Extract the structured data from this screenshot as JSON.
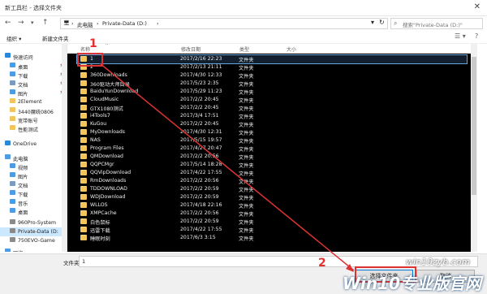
{
  "window": {
    "title": "新工具栏 - 选择文件夹",
    "close_glyph": "✕"
  },
  "nav": {
    "back": "←",
    "forward": "→",
    "dropdown": "▾",
    "up": "↑",
    "refresh": "↻"
  },
  "address": {
    "crumbs": [
      "🖥",
      "›",
      "此电脑",
      "›",
      "Private-Data (D:)",
      "›"
    ]
  },
  "search": {
    "placeholder": "搜索\"Private-Data (D:)\""
  },
  "toolbar": {
    "organize": "组织 ▾",
    "new_folder": "新建文件夹",
    "view_glyph": "☰ ▾",
    "help_glyph": "?"
  },
  "sidebar": {
    "items": [
      {
        "label": "快速访问",
        "icon": "star",
        "color": "#2b87d8",
        "pin": ""
      },
      {
        "label": "桌面",
        "icon": "desktop",
        "color": "#4d9be0",
        "pin": "📌"
      },
      {
        "label": "下载",
        "icon": "download",
        "color": "#4d9be0",
        "pin": "📌"
      },
      {
        "label": "文档",
        "icon": "documents",
        "color": "#7a9bbd",
        "pin": "📌"
      },
      {
        "label": "图片",
        "icon": "pictures",
        "color": "#4d9be0",
        "pin": "📌"
      },
      {
        "label": "2Element",
        "icon": "folder",
        "color": "#f2c55c",
        "pin": ""
      },
      {
        "label": "3440魔统0806",
        "icon": "folder",
        "color": "#f2c55c",
        "pin": ""
      },
      {
        "label": "宽带账号",
        "icon": "folder",
        "color": "#f2c55c",
        "pin": ""
      },
      {
        "label": "性能测试",
        "icon": "folder",
        "color": "#f2c55c",
        "pin": ""
      },
      {
        "label": "OneDrive",
        "icon": "cloud",
        "color": "#2b87d8",
        "pin": ""
      },
      {
        "label": "此电脑",
        "icon": "computer",
        "color": "#4d9be0",
        "pin": ""
      },
      {
        "label": "视频",
        "icon": "videos",
        "color": "#4d9be0",
        "pin": ""
      },
      {
        "label": "图片",
        "icon": "pictures",
        "color": "#4d9be0",
        "pin": ""
      },
      {
        "label": "文档",
        "icon": "documents",
        "color": "#7a9bbd",
        "pin": ""
      },
      {
        "label": "下载",
        "icon": "download",
        "color": "#4d9be0",
        "pin": ""
      },
      {
        "label": "音乐",
        "icon": "music",
        "color": "#4d9be0",
        "pin": ""
      },
      {
        "label": "桌面",
        "icon": "desktop",
        "color": "#4d9be0",
        "pin": ""
      },
      {
        "label": "960Pro-System",
        "icon": "drive",
        "color": "#8a8a8a",
        "pin": ""
      },
      {
        "label": "Private-Data (D:",
        "icon": "drive",
        "color": "#8a8a8a",
        "pin": ""
      },
      {
        "label": "750EVO-Game",
        "icon": "drive",
        "color": "#8a8a8a",
        "pin": ""
      },
      {
        "label": "网络",
        "icon": "network",
        "color": "#4d9be0",
        "pin": ""
      }
    ]
  },
  "columns": {
    "name": "名称",
    "date": "修改日期",
    "type": "类型",
    "size": "大小"
  },
  "files": [
    {
      "name": "1",
      "date": "2017/2/16 22:23",
      "type": "文件夹"
    },
    {
      "name": "2",
      "date": "2017/2/13 21:11",
      "type": "文件夹"
    },
    {
      "name": "360Downloads",
      "date": "2017/4/30 12:33",
      "type": "文件夹"
    },
    {
      "name": "360驱动大师目录",
      "date": "2017/5/23 2:35",
      "type": "文件夹"
    },
    {
      "name": "BaiduYunDownload",
      "date": "2017/5/29 11:23",
      "type": "文件夹"
    },
    {
      "name": "CloudMusic",
      "date": "2017/2/2 20:45",
      "type": "文件夹"
    },
    {
      "name": "GTX1080测试",
      "date": "2017/2/2 20:45",
      "type": "文件夹"
    },
    {
      "name": "i4Tools7",
      "date": "2017/3/4 17:51",
      "type": "文件夹"
    },
    {
      "name": "KuGou",
      "date": "2017/2/2 20:45",
      "type": "文件夹"
    },
    {
      "name": "MyDownloads",
      "date": "2017/4/30 12:31",
      "type": "文件夹"
    },
    {
      "name": "NAS",
      "date": "2017/5/15 19:57",
      "type": "文件夹"
    },
    {
      "name": "Program Files",
      "date": "2017/4/27 20:47",
      "type": "文件夹"
    },
    {
      "name": "QMDownload",
      "date": "2017/2/2 20:56",
      "type": "文件夹"
    },
    {
      "name": "QQPCMgr",
      "date": "2017/5/14 18:28",
      "type": "文件夹"
    },
    {
      "name": "QQVipDownload",
      "date": "2017/4/22 17:55",
      "type": "文件夹"
    },
    {
      "name": "RmDownloads",
      "date": "2017/2/2 20:56",
      "type": "文件夹"
    },
    {
      "name": "TDDOWNLOAD",
      "date": "2017/2/2 20:59",
      "type": "文件夹"
    },
    {
      "name": "WDJDownload",
      "date": "2017/2/2 20:59",
      "type": "文件夹"
    },
    {
      "name": "WLLOS",
      "date": "2017/4/18 22:16",
      "type": "文件夹"
    },
    {
      "name": "XMPCache",
      "date": "2017/2/2 20:56",
      "type": "文件夹"
    },
    {
      "name": "白色鼠标",
      "date": "2017/2/2 20:59",
      "type": "文件夹"
    },
    {
      "name": "迅雷下载",
      "date": "2017/4/22 17:55",
      "type": "文件夹"
    },
    {
      "name": "睡眠时刻",
      "date": "2017/6/3 3:15",
      "type": "文件夹"
    }
  ],
  "footer": {
    "folder_label": "文件夹:",
    "folder_value": "1",
    "select_button": "选择文件夹",
    "cancel_button": "取消"
  },
  "annotation": {
    "badge1": "1",
    "badge2": "2",
    "color": "#e53030"
  },
  "watermark": {
    "line1": "win10zyb.com",
    "line2": "Win10专业版官网"
  }
}
